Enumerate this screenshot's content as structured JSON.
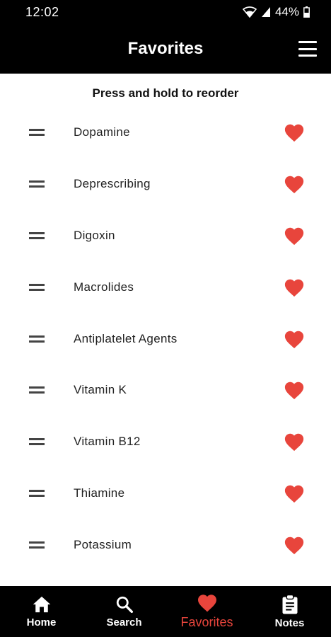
{
  "status_bar": {
    "time": "12:02",
    "battery": "44%",
    "icons": [
      "wifi-icon",
      "signal-icon",
      "battery-icon"
    ]
  },
  "app_bar": {
    "title": "Favorites",
    "menu_icon": "hamburger-menu-icon"
  },
  "hint": "Press and hold to reorder",
  "favorites": [
    {
      "label": "Dopamine"
    },
    {
      "label": "Deprescribing"
    },
    {
      "label": "Digoxin"
    },
    {
      "label": "Macrolides"
    },
    {
      "label": "Antiplatelet Agents"
    },
    {
      "label": "Vitamin K"
    },
    {
      "label": "Vitamin B12"
    },
    {
      "label": "Thiamine"
    },
    {
      "label": "Potassium"
    }
  ],
  "bottom_nav": [
    {
      "label": "Home",
      "icon": "home-icon"
    },
    {
      "label": "Search",
      "icon": "search-icon"
    },
    {
      "label": "Favorites",
      "icon": "heart-icon",
      "active": true
    },
    {
      "label": "Notes",
      "icon": "clipboard-icon"
    }
  ],
  "colors": {
    "accent": "#e8453c",
    "bar_background": "#000000",
    "background": "#ffffff"
  }
}
